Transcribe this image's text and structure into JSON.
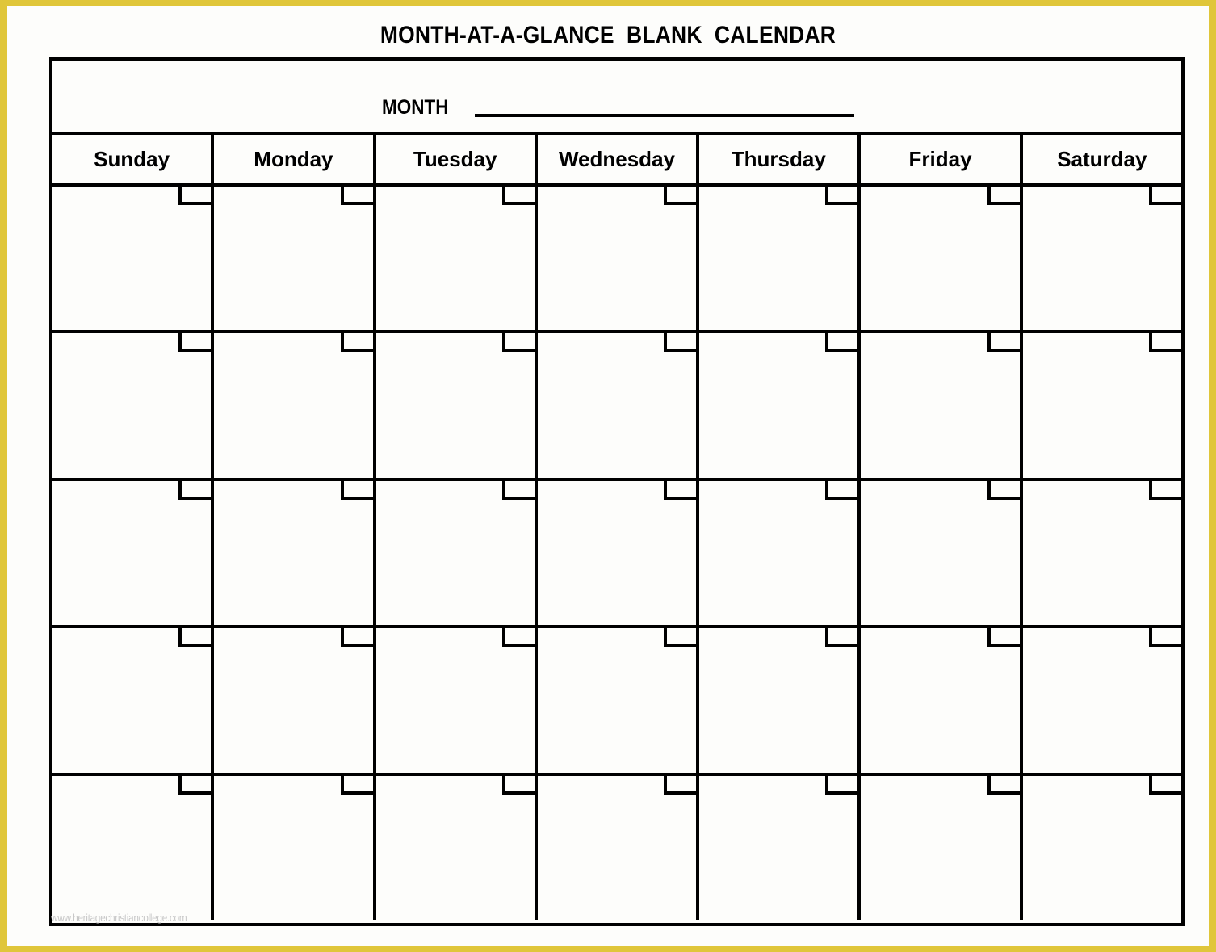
{
  "page": {
    "title": "MONTH-AT-A-GLANCE  BLANK  CALENDAR",
    "background_color": "#fdfdfb",
    "border_color": "#e0c63a",
    "ink_color": "#000000",
    "watermark": "www.heritagechristiancollege.com"
  },
  "month_field": {
    "label": "MONTH",
    "value": "",
    "placeholder": ""
  },
  "weekdays": [
    {
      "label": "Sunday"
    },
    {
      "label": "Monday"
    },
    {
      "label": "Tuesday"
    },
    {
      "label": "Wednesday"
    },
    {
      "label": "Thursday"
    },
    {
      "label": "Friday"
    },
    {
      "label": "Saturday"
    }
  ],
  "weeks": [
    {
      "days": [
        {
          "date": "",
          "note": ""
        },
        {
          "date": "",
          "note": ""
        },
        {
          "date": "",
          "note": ""
        },
        {
          "date": "",
          "note": ""
        },
        {
          "date": "",
          "note": ""
        },
        {
          "date": "",
          "note": ""
        },
        {
          "date": "",
          "note": ""
        }
      ]
    },
    {
      "days": [
        {
          "date": "",
          "note": ""
        },
        {
          "date": "",
          "note": ""
        },
        {
          "date": "",
          "note": ""
        },
        {
          "date": "",
          "note": ""
        },
        {
          "date": "",
          "note": ""
        },
        {
          "date": "",
          "note": ""
        },
        {
          "date": "",
          "note": ""
        }
      ]
    },
    {
      "days": [
        {
          "date": "",
          "note": ""
        },
        {
          "date": "",
          "note": ""
        },
        {
          "date": "",
          "note": ""
        },
        {
          "date": "",
          "note": ""
        },
        {
          "date": "",
          "note": ""
        },
        {
          "date": "",
          "note": ""
        },
        {
          "date": "",
          "note": ""
        }
      ]
    },
    {
      "days": [
        {
          "date": "",
          "note": ""
        },
        {
          "date": "",
          "note": ""
        },
        {
          "date": "",
          "note": ""
        },
        {
          "date": "",
          "note": ""
        },
        {
          "date": "",
          "note": ""
        },
        {
          "date": "",
          "note": ""
        },
        {
          "date": "",
          "note": ""
        }
      ]
    },
    {
      "days": [
        {
          "date": "",
          "note": ""
        },
        {
          "date": "",
          "note": ""
        },
        {
          "date": "",
          "note": ""
        },
        {
          "date": "",
          "note": ""
        },
        {
          "date": "",
          "note": ""
        },
        {
          "date": "",
          "note": ""
        },
        {
          "date": "",
          "note": ""
        }
      ]
    }
  ]
}
